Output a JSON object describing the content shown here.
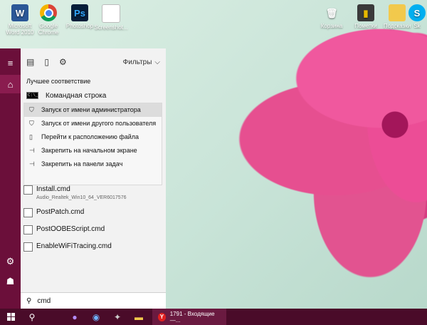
{
  "desktop": {
    "icons_left": [
      {
        "label": "Microsoft Word 2010",
        "icon": "word-icon"
      },
      {
        "label": "Google Chrome",
        "icon": "chrome-icon"
      },
      {
        "label": "Photoshop",
        "icon": "photoshop-icon"
      },
      {
        "label": "Screenshot...",
        "icon": "file-icon"
      }
    ],
    "icons_right": [
      {
        "label": "Корзина",
        "icon": "recycle-bin-icon"
      },
      {
        "label": "Пометки",
        "icon": "notes-icon"
      },
      {
        "label": "Подсказки",
        "icon": "folder-icon"
      },
      {
        "label": "Sk",
        "icon": "skype-icon"
      }
    ]
  },
  "toolbar": {
    "filters_label": "Фильтры"
  },
  "best_match": {
    "title": "Лучшее соответствие",
    "app_name": "Командная строка",
    "app_icon_text": "C:\\_"
  },
  "context_menu": [
    {
      "label": "Запуск от имени администратора",
      "icon": "shield-icon"
    },
    {
      "label": "Запуск от имени другого пользователя",
      "icon": "user-run-icon"
    },
    {
      "label": "Перейти к расположению файла",
      "icon": "folder-open-icon"
    },
    {
      "label": "Закрепить на начальном экране",
      "icon": "pin-icon"
    },
    {
      "label": "Закрепить на панели задач",
      "icon": "pin-icon"
    }
  ],
  "results": [
    {
      "name": "Install.cmd",
      "sub": "Audio_Realtek_Win10_64_VER6017576"
    },
    {
      "name": "PostPatch.cmd",
      "sub": ""
    },
    {
      "name": "PostOOBEScript.cmd",
      "sub": ""
    },
    {
      "name": "EnableWiFiTracing.cmd",
      "sub": ""
    }
  ],
  "search": {
    "query": "cmd"
  },
  "taskbar": {
    "active_window_label": "1791 - Входящие —..."
  }
}
